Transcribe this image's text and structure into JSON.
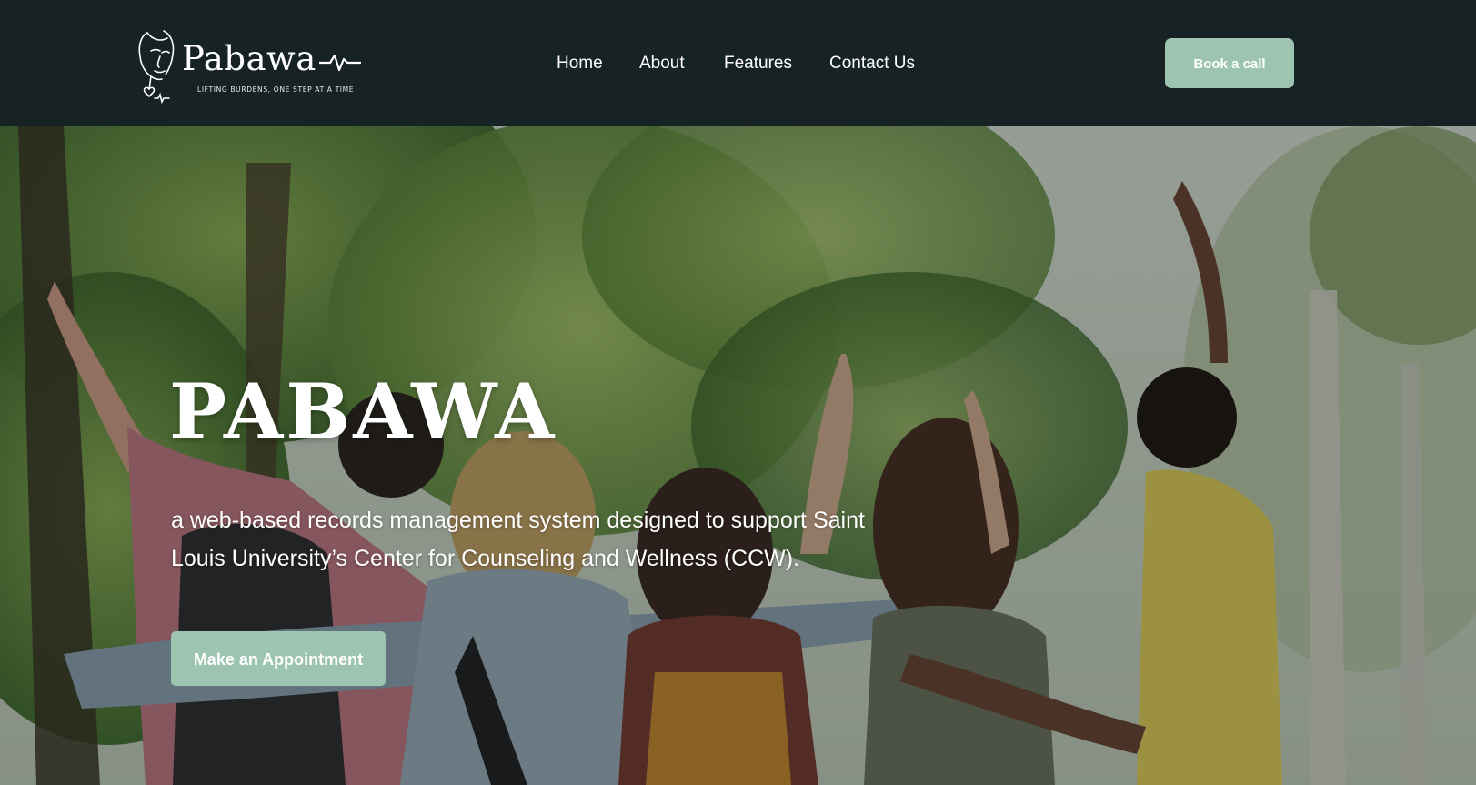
{
  "header": {
    "logo": {
      "wordmark": "Pabawa",
      "tagline": "LIFTING BURDENS, ONE STEP AT A TIME"
    },
    "nav": [
      {
        "label": "Home"
      },
      {
        "label": "About"
      },
      {
        "label": "Features"
      },
      {
        "label": "Contact Us"
      }
    ],
    "book_call_label": "Book a call"
  },
  "hero": {
    "title": "PABAWA",
    "description": "a web-based records management system designed to support Saint Louis University’s Center for Counseling and Wellness (CCW).",
    "cta_label": "Make an Appointment",
    "background": "photo of students with raised arms under trees"
  },
  "colors": {
    "header_bg": "#172224",
    "accent": "#9cc4b0",
    "text": "#ffffff"
  }
}
